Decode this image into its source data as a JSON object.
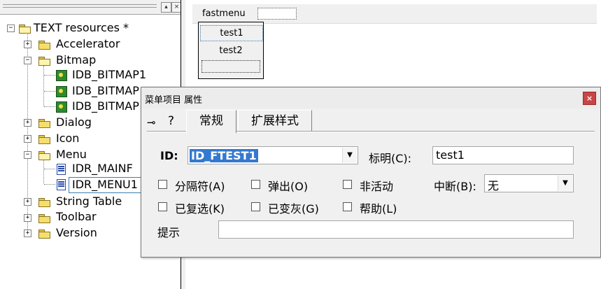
{
  "tree": {
    "root": "TEXT resources *",
    "items": [
      {
        "label": "Accelerator"
      },
      {
        "label": "Bitmap"
      },
      {
        "label": "IDB_BITMAP1"
      },
      {
        "label": "IDB_BITMAP"
      },
      {
        "label": "IDB_BITMAP"
      },
      {
        "label": "Dialog"
      },
      {
        "label": "Icon"
      },
      {
        "label": "Menu"
      },
      {
        "label": "IDR_MAINF"
      },
      {
        "label": "IDR_MENU1"
      },
      {
        "label": "String Table"
      },
      {
        "label": "Toolbar"
      },
      {
        "label": "Version"
      }
    ]
  },
  "menu_editor": {
    "bar_item": "fastmenu",
    "dropdown_items": [
      "test1",
      "test2"
    ]
  },
  "dialog": {
    "title": "菜单项目 属性",
    "close": "×",
    "tabs": [
      "常规",
      "扩展样式"
    ],
    "id_label": "ID:",
    "id_value": "ID_FTEST1",
    "caption_label": "标明(C):",
    "caption_value": "test1",
    "checkboxes": {
      "separator": "分隔符(A)",
      "popup": "弹出(O)",
      "inactive": "非活动",
      "checked": "已复选(K)",
      "grayed": "已变灰(G)",
      "help": "帮助(L)"
    },
    "break_label": "中断(B):",
    "break_value": "无",
    "prompt_label": "提示",
    "prompt_value": ""
  },
  "icons": {
    "pin": "pin-icon",
    "help": "help-icon",
    "folder": "folder-icon",
    "bitmap": "bitmap-icon",
    "menu": "menu-icon"
  },
  "colors": {
    "selection": "#3379d1",
    "close_button": "#c84646",
    "folder": "#f6de6c"
  }
}
